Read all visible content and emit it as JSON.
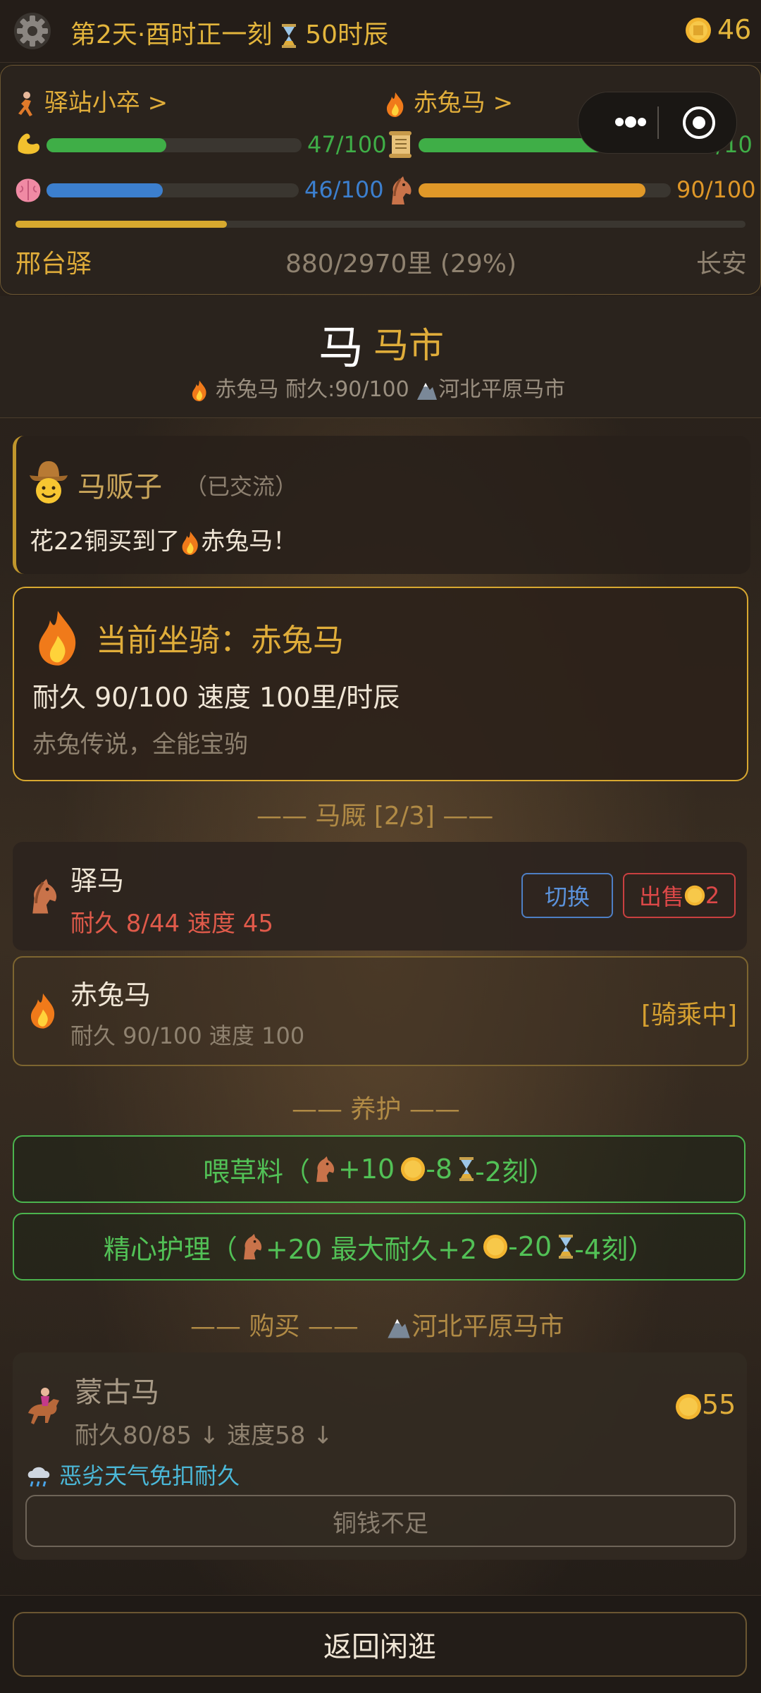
{
  "topbar": {
    "day_text": "第2天·酉时正一刻",
    "hours_text": "50时辰",
    "coins": "46"
  },
  "status": {
    "character_link": "驿站小卒 >",
    "horse_link": "赤兔马 >",
    "strength": {
      "text": "47/100",
      "fraction": 0.47,
      "color": "#3fae47"
    },
    "scroll": {
      "text": "8/10",
      "fraction": 0.8,
      "color": "#3fae47"
    },
    "mind": {
      "text": "46/100",
      "fraction": 0.46,
      "color": "#3c7fce"
    },
    "horse": {
      "text": "90/100",
      "fraction": 0.9,
      "color": "#e09828"
    },
    "route": {
      "from": "邢台驿",
      "distance": "880/2970里 (29%)",
      "to": "长安",
      "fraction": 0.29
    }
  },
  "market": {
    "big_char": "马",
    "title": "马市",
    "sub": "赤兔马 耐久:90/100",
    "location": "河北平原马市"
  },
  "dealer": {
    "name": "马贩子",
    "tag": "（已交流）",
    "msg_prefix": "花22铜买到了",
    "msg_suffix": "赤兔马！"
  },
  "current": {
    "title": "当前坐骑：赤兔马",
    "stats": "耐久 90/100  速度 100里/时辰",
    "desc": "赤兔传说，全能宝驹"
  },
  "stable": {
    "header": "—— 马厩 [2/3] ——",
    "rows": [
      {
        "name": "驿马",
        "stats": "耐久 8/44  速度 45",
        "switch_label": "切换",
        "sell_label": "出售",
        "sell_price": "2"
      },
      {
        "name": "赤兔马",
        "stats": "耐久 90/100  速度 100",
        "status": "[骑乘中]"
      }
    ]
  },
  "care": {
    "header": "—— 养护 ——",
    "feed": {
      "label": "喂草料（",
      "horse_plus": "+10",
      "coin_minus": "-8",
      "time_minus": "-2刻）"
    },
    "groom": {
      "label": "精心护理（",
      "horse_plus": "+20 最大耐久+2",
      "coin_minus": "-20",
      "time_minus": "-4刻）"
    }
  },
  "buy": {
    "header": "—— 购买 ——",
    "location": "河北平原马市",
    "horse": {
      "name": "蒙古马",
      "stats": "耐久80/85 ↓  速度58 ↓",
      "price": "55",
      "perk": "恶劣天气免扣耐久"
    },
    "button": "铜钱不足"
  },
  "footer": {
    "back": "返回闲逛"
  }
}
